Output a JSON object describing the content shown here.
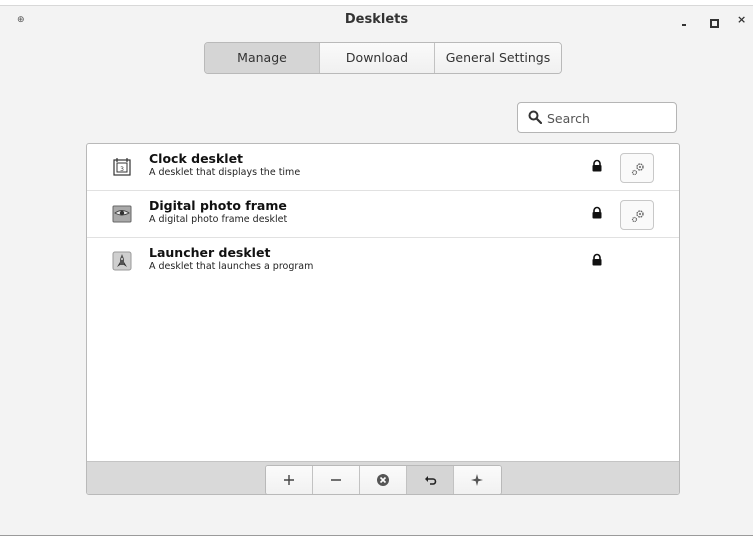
{
  "window": {
    "title": "Desklets",
    "controls": [
      "minimize-icon",
      "maximize-icon",
      "close-icon"
    ]
  },
  "tabs": [
    {
      "label": "Manage",
      "active": true
    },
    {
      "label": "Download",
      "active": false
    },
    {
      "label": "General Settings",
      "active": false
    }
  ],
  "search": {
    "placeholder": "Search",
    "value": ""
  },
  "desklets": [
    {
      "name": "Clock desklet",
      "description": "A desklet that displays the time",
      "icon": "clock-desklet-icon",
      "locked": true,
      "has_settings": true
    },
    {
      "name": "Digital photo frame",
      "description": "A digital photo frame desklet",
      "icon": "photo-frame-icon",
      "locked": true,
      "has_settings": true
    },
    {
      "name": "Launcher desklet",
      "description": "A desklet that launches a program",
      "icon": "launcher-icon",
      "locked": true,
      "has_settings": false
    }
  ],
  "toolbar": {
    "buttons": [
      "add-icon",
      "remove-icon",
      "clear-icon",
      "undo-icon",
      "sparkle-icon"
    ]
  },
  "colors": {
    "window_bg": "#f3f3f3",
    "active_tab": "#d5d5d5",
    "toolbar_bg": "#d9d9d9"
  }
}
